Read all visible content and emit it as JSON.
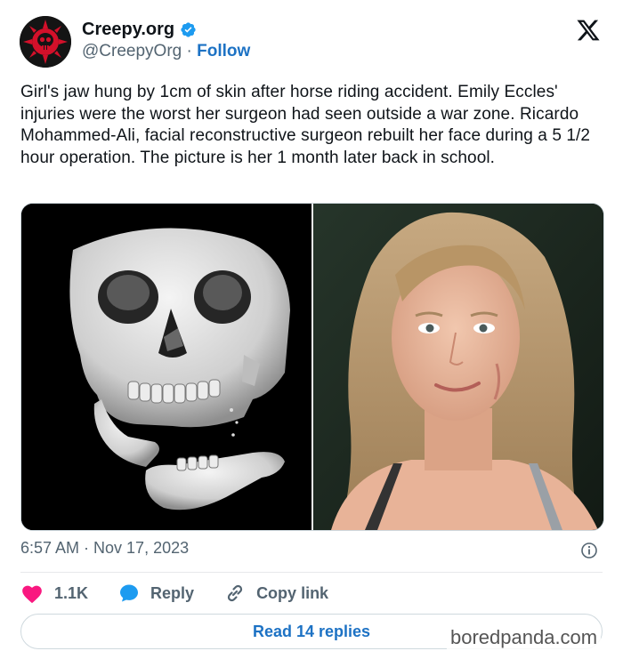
{
  "tweet": {
    "display_name": "Creepy.org",
    "handle": "@CreepyOrg",
    "separator": "·",
    "follow_label": "Follow",
    "text": "Girl's jaw hung by 1cm of skin after horse riding accident. Emily Eccles' injuries were the worst her surgeon had seen outside a war zone. Ricardo Mohammed-Ali, facial reconstructive surgeon rebuilt her face during a 5 1/2 hour operation. The picture is her 1 month later back in school.",
    "timestamp": "6:57 AM · Nov 17, 2023"
  },
  "actions": {
    "likes": "1.1K",
    "reply_label": "Reply",
    "copy_link_label": "Copy link"
  },
  "read_replies_label": "Read 14 replies",
  "watermark": "boredpanda.com",
  "colors": {
    "accent": "#1d72c4",
    "like": "#f91880",
    "verified": "#1d9bf0",
    "muted_text": "#536471"
  },
  "icons": {
    "avatar": "skull-logo-icon",
    "verified": "verified-badge-icon",
    "brand": "x-logo-icon",
    "info": "info-icon",
    "like": "heart-icon",
    "reply": "speech-bubble-icon",
    "copy": "link-icon"
  }
}
